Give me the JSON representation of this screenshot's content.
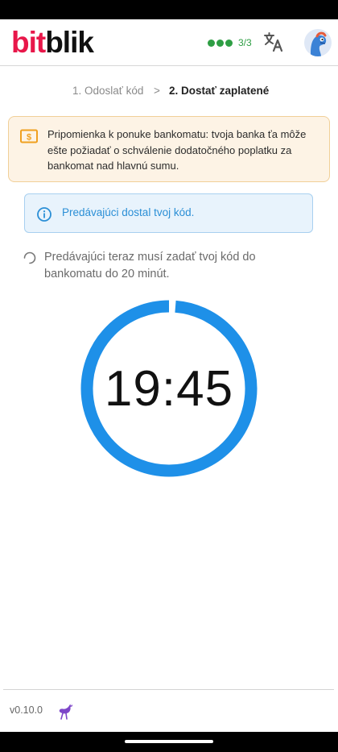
{
  "header": {
    "logo_part1": "bit",
    "logo_part2": "blik",
    "progress_text": "3/3",
    "progress_dots": 3
  },
  "stepper": {
    "step1": "1. Odoslať kód",
    "separator": ">",
    "step2": "2. Dostať zaplatené"
  },
  "warning": {
    "text": "Pripomienka k ponuke bankomatu: tvoja banka ťa môže ešte požiadať o schválenie dodatočného poplatku za bankomat nad hlavnú sumu.",
    "icon": "dollar-bill-icon",
    "color": "#f0a020"
  },
  "info": {
    "text": "Predávajúci dostal tvoj kód.",
    "icon": "info-icon",
    "color": "#2b8fd6"
  },
  "waiting": {
    "text": "Predávajúci teraz musí zadať tvoj kód do bankomatu do 20 minút."
  },
  "timer": {
    "time": "19:45",
    "remaining_fraction": 0.9875,
    "color": "#1e90e8"
  },
  "footer": {
    "version": "v0.10.0",
    "icon": "emu-icon"
  }
}
